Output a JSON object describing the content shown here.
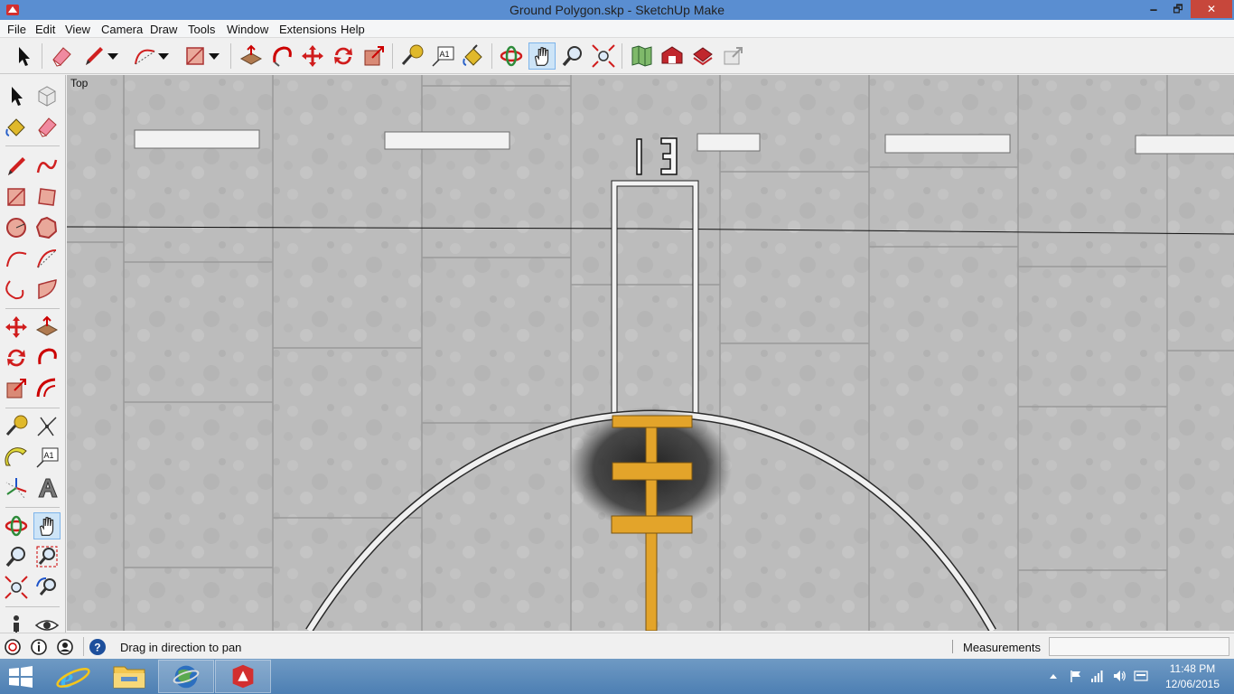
{
  "window": {
    "title": "Ground Polygon.skp - SketchUp Make",
    "minimize_label": "🗕",
    "maximize_label": "🗗",
    "close_label": "✕"
  },
  "menu": [
    "File",
    "Edit",
    "View",
    "Camera",
    "Draw",
    "Tools",
    "Window",
    "Extensions",
    "Help"
  ],
  "toolbar": {
    "icons": [
      "select-icon",
      "eraser-icon",
      "pencil-icon",
      "dropdown-icon",
      "arc-icon",
      "dropdown-icon",
      "rectangle-icon",
      "dropdown-icon",
      "push-pull-icon",
      "follow-me-icon",
      "move-icon",
      "rotate-icon",
      "scale-icon",
      "tape-measure-icon",
      "text-icon",
      "paint-bucket-icon",
      "orbit-icon",
      "pan-icon",
      "zoom-icon",
      "zoom-extents-icon",
      "map-icon",
      "warehouse-icon",
      "extension-warehouse-icon",
      "share-model-icon"
    ],
    "active_tool": "pan-icon"
  },
  "viewport": {
    "view_label": "Top",
    "model_numbers": "13"
  },
  "status": {
    "message": "Drag in direction to pan",
    "measurements_label": "Measurements",
    "measurements_value": ""
  },
  "taskbar": {
    "time": "11:48 PM",
    "date": "12/06/2015"
  },
  "colors": {
    "titlebar": "#5a8ed1",
    "close_button": "#c7473b",
    "concrete": "#bdbdbd",
    "orange_stripe": "#e3a42a",
    "taskbar": "#5b88b8"
  }
}
